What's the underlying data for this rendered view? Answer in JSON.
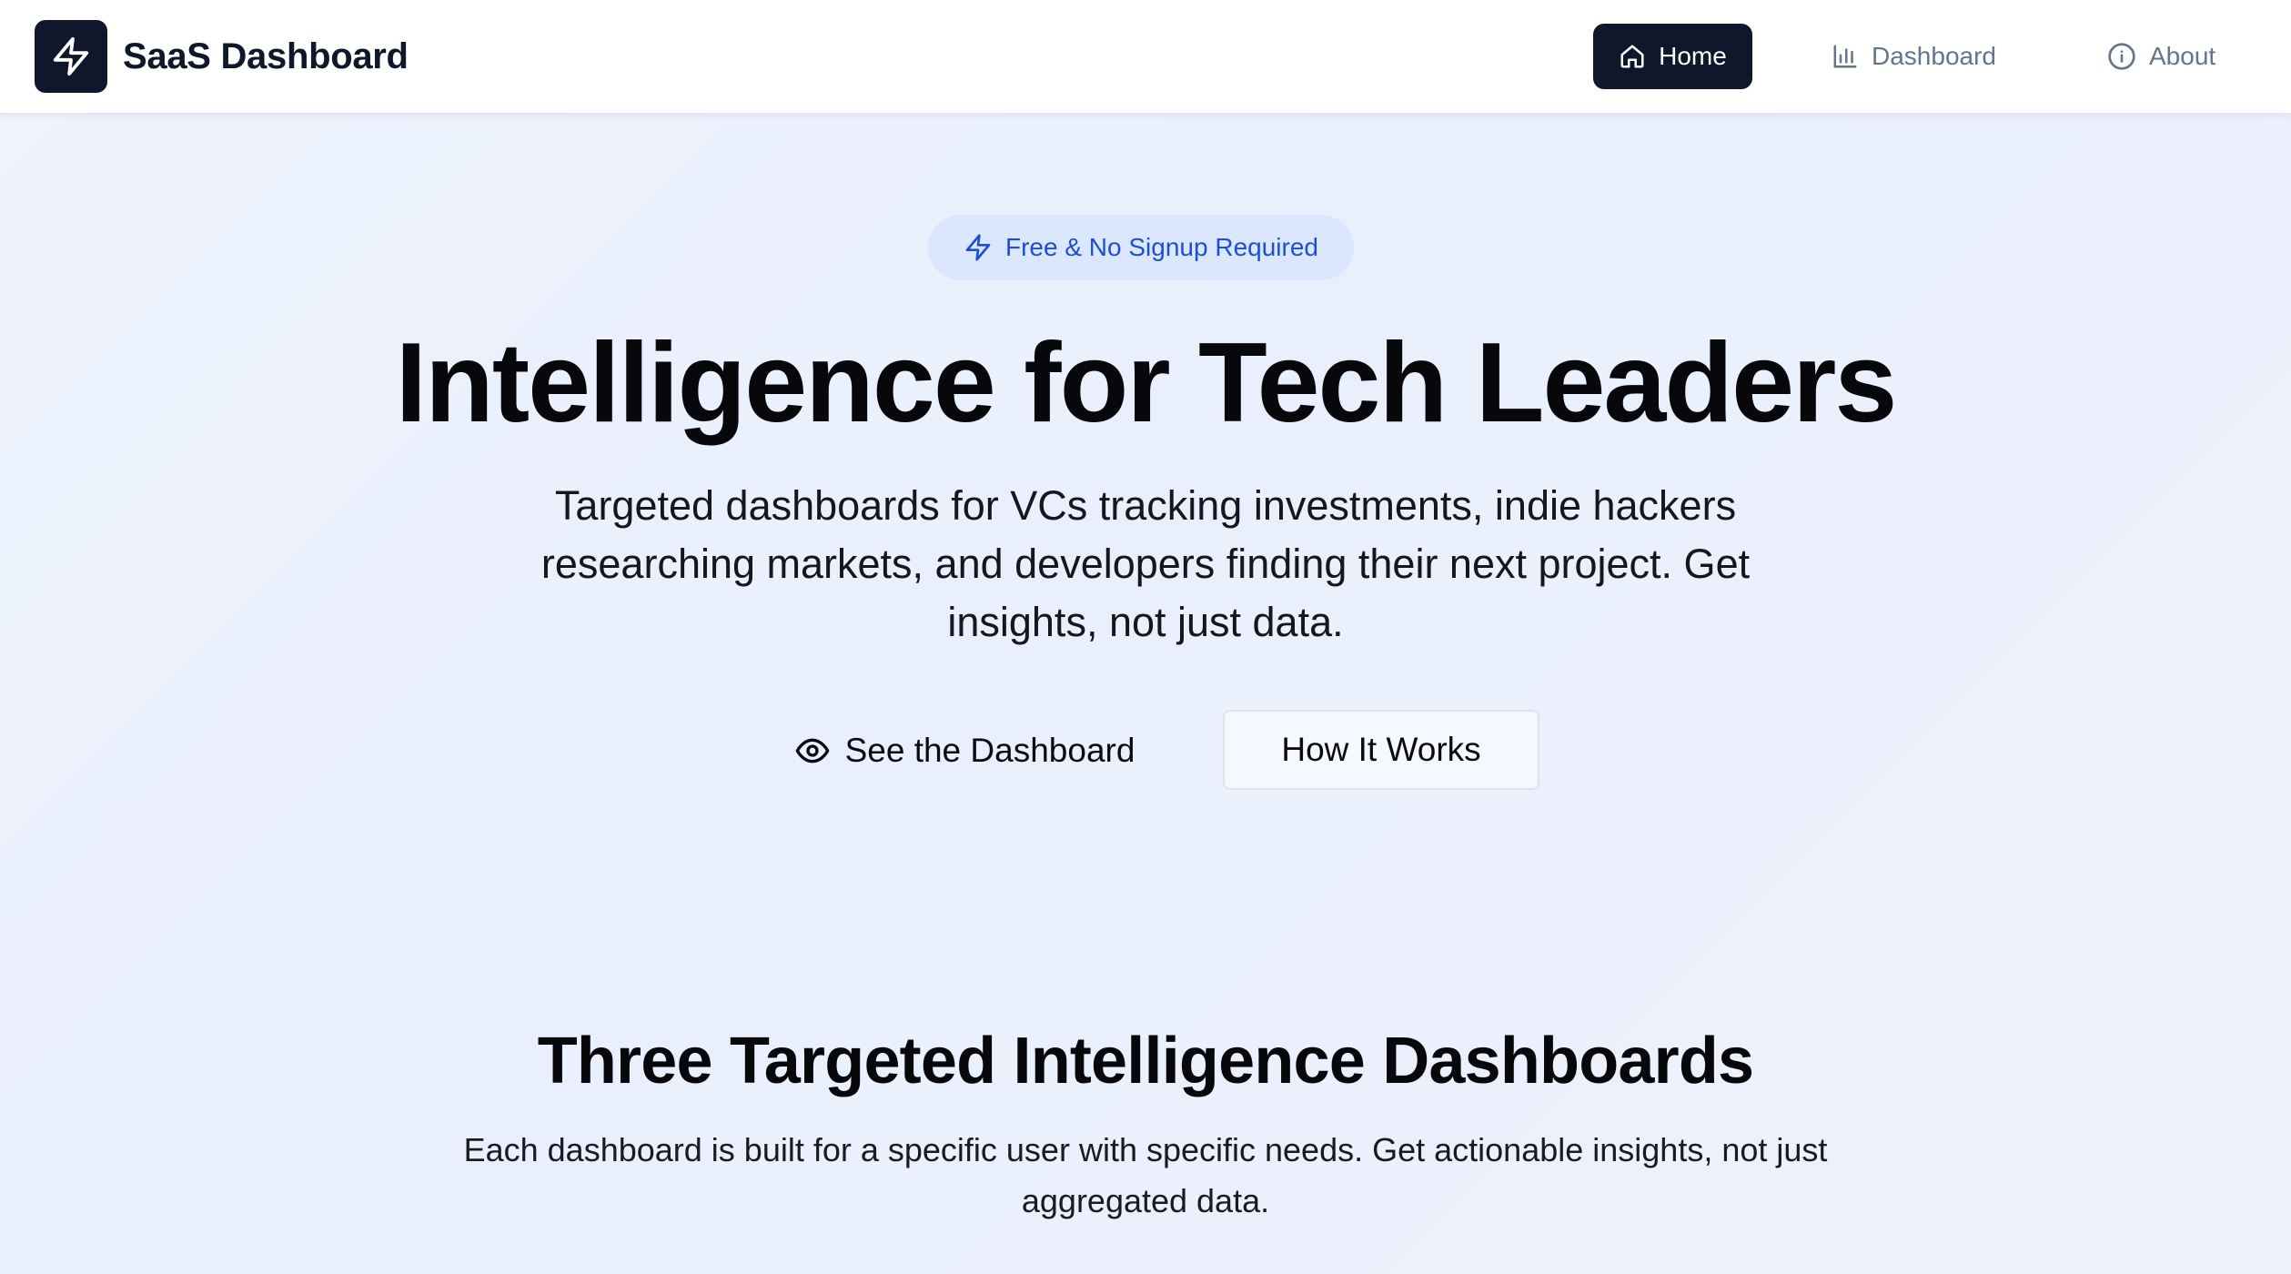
{
  "brand": {
    "name": "SaaS Dashboard",
    "logo_icon": "lightning-bolt-icon"
  },
  "nav": {
    "items": [
      {
        "label": "Home",
        "icon": "home-icon",
        "active": true
      },
      {
        "label": "Dashboard",
        "icon": "bar-chart-icon",
        "active": false
      },
      {
        "label": "About",
        "icon": "info-circle-icon",
        "active": false
      }
    ]
  },
  "hero": {
    "badge": {
      "label": "Free & No Signup Required",
      "icon": "lightning-bolt-icon"
    },
    "title": "Intelligence for Tech Leaders",
    "subtitle": "Targeted dashboards for VCs tracking investments, indie hackers researching markets, and developers finding their next project. Get insights, not just data.",
    "primary_button": {
      "label": "See the Dashboard",
      "icon": "eye-icon"
    },
    "secondary_button": {
      "label": "How It Works"
    }
  },
  "section": {
    "title": "Three Targeted Intelligence Dashboards",
    "subtitle": "Each dashboard is built for a specific user with specific needs. Get actionable insights, not just aggregated data."
  },
  "colors": {
    "brand_dark": "#0f172a",
    "badge_bg": "#dbe7fe",
    "badge_text": "#1d4ed8",
    "nav_inactive": "#64748b",
    "page_bg": "#eaf0fc"
  }
}
